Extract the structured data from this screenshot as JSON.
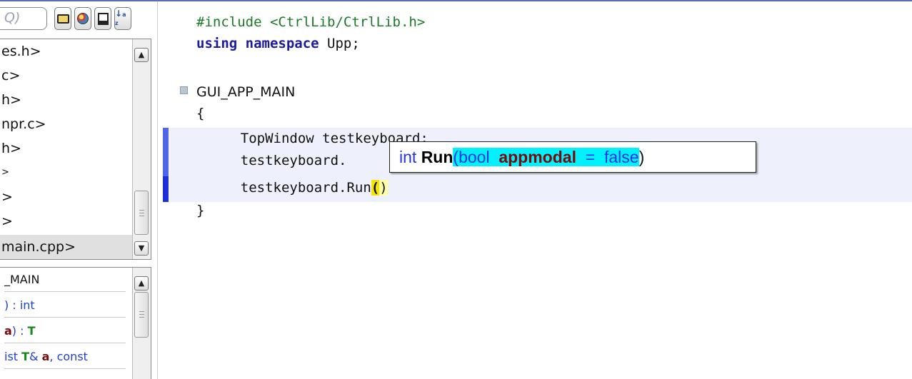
{
  "sidebar": {
    "search_text": "Q)",
    "toolbar_buttons": [
      "folder-icon",
      "globe-icon",
      "window-icon",
      "sort-icon"
    ],
    "sort_glyph": "↓",
    "sort_digits": "a z",
    "files": [
      "es.h>",
      "c>",
      "h>",
      "npr.c>",
      "h>",
      ">",
      ">",
      ">",
      "main.cpp>"
    ],
    "selected_file_index": 8,
    "symbols": [
      {
        "parts": [
          {
            "t": "_MAIN",
            "c": "blk"
          }
        ]
      },
      {
        "parts": [
          {
            "t": ")",
            "c": "blue"
          },
          {
            "t": " : int",
            "c": "blue"
          }
        ]
      },
      {
        "parts": [
          {
            "t": "a",
            "c": "dred"
          },
          {
            "t": ") : ",
            "c": "blue"
          },
          {
            "t": "T",
            "c": "green"
          }
        ]
      },
      {
        "parts": [
          {
            "t": "ist ",
            "c": "blue"
          },
          {
            "t": "T",
            "c": "green"
          },
          {
            "t": "& ",
            "c": "blue"
          },
          {
            "t": "a",
            "c": "dred"
          },
          {
            "t": ", const",
            "c": "blue"
          }
        ]
      }
    ]
  },
  "editor": {
    "line1_directive": "#include",
    "line1_path": " <CtrlLib/CtrlLib.h>",
    "line2_kw": "using namespace",
    "line2_rest": " Upp;",
    "line4": "GUI_APP_MAIN",
    "line5": "{",
    "line6": "    TopWindow testkeyboard;",
    "line7": "    testkeyboard.",
    "line8_pre": "    testkeyboard.Run",
    "line8_open": "(",
    "line8_close": ")",
    "line9": "}"
  },
  "tooltip": {
    "ret_type": "int",
    "fn_name": "Run",
    "open": "(",
    "param_type": "bool",
    "param_name": "appmodal",
    "eq": "=",
    "default": "false",
    "close": ")"
  },
  "colors": {
    "marker_bar": "#5066e8",
    "line_highlight": "#eef0fb",
    "tooltip_param_highlight": "#00f2ff",
    "paren_match": "#f5e600"
  }
}
